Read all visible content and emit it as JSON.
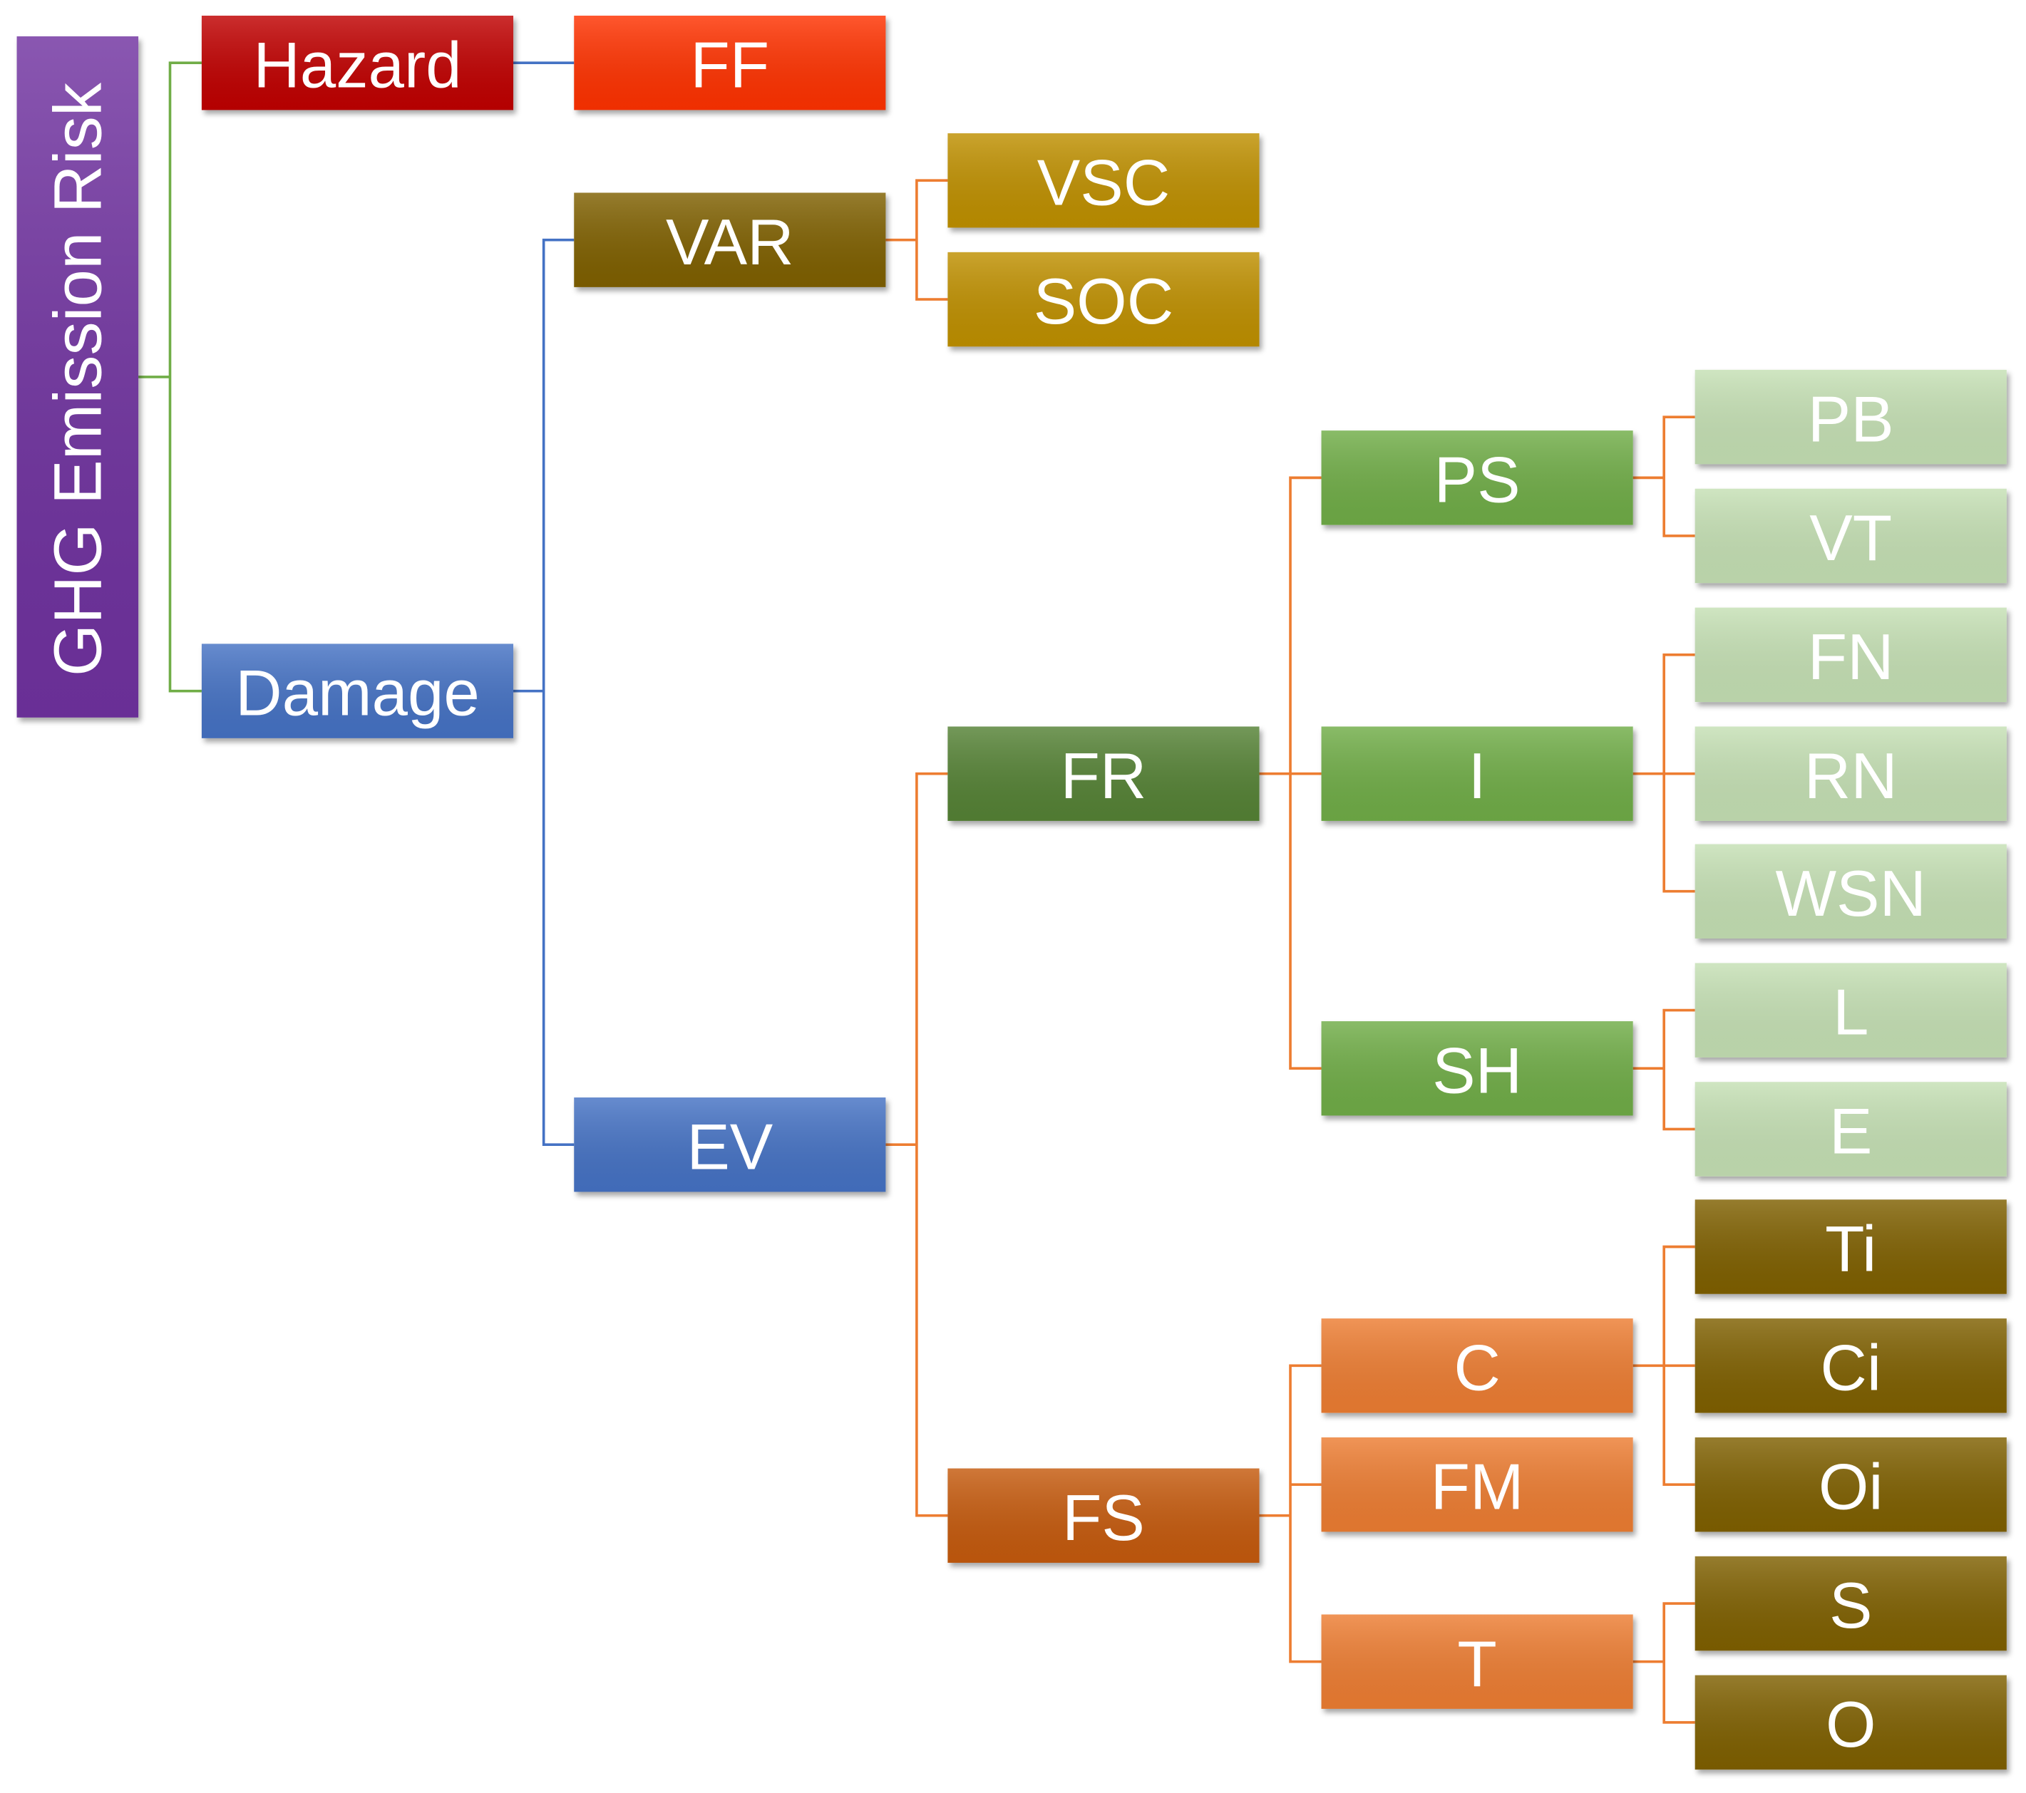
{
  "diagram": {
    "nodes": [
      {
        "id": "root",
        "label": "GHG Emission Risk",
        "parent": null,
        "color": "#7030a0"
      },
      {
        "id": "hazard",
        "label": "Hazard",
        "parent": "root",
        "color": "#c00000"
      },
      {
        "id": "ff",
        "label": "FF",
        "parent": "hazard",
        "color": "#ff3300"
      },
      {
        "id": "damage",
        "label": "Damage",
        "parent": "root",
        "color": "#4472c4"
      },
      {
        "id": "var",
        "label": "VAR",
        "parent": "damage",
        "color": "#7f6000"
      },
      {
        "id": "vsc",
        "label": "VSC",
        "parent": "var",
        "color": "#bf9000"
      },
      {
        "id": "soc",
        "label": "SOC",
        "parent": "var",
        "color": "#bf9000"
      },
      {
        "id": "ev",
        "label": "EV",
        "parent": "damage",
        "color": "#4472c4"
      },
      {
        "id": "fr",
        "label": "FR",
        "parent": "ev",
        "color": "#548235"
      },
      {
        "id": "ps",
        "label": "PS",
        "parent": "fr",
        "color": "#70ad47"
      },
      {
        "id": "pb",
        "label": "PB",
        "parent": "ps",
        "color": "#c5e0b4"
      },
      {
        "id": "vt",
        "label": "VT",
        "parent": "ps",
        "color": "#c5e0b4"
      },
      {
        "id": "i",
        "label": "I",
        "parent": "fr",
        "color": "#70ad47"
      },
      {
        "id": "fn",
        "label": "FN",
        "parent": "i",
        "color": "#c5e0b4"
      },
      {
        "id": "rn",
        "label": "RN",
        "parent": "i",
        "color": "#c5e0b4"
      },
      {
        "id": "wsn",
        "label": "WSN",
        "parent": "i",
        "color": "#c5e0b4"
      },
      {
        "id": "sh",
        "label": "SH",
        "parent": "fr",
        "color": "#70ad47"
      },
      {
        "id": "l",
        "label": "L",
        "parent": "sh",
        "color": "#c5e0b4"
      },
      {
        "id": "e",
        "label": "E",
        "parent": "sh",
        "color": "#c5e0b4"
      },
      {
        "id": "fs",
        "label": "FS",
        "parent": "ev",
        "color": "#c55a11"
      },
      {
        "id": "c",
        "label": "C",
        "parent": "fs",
        "color": "#ed7d31"
      },
      {
        "id": "ti",
        "label": "Ti",
        "parent": "c",
        "color": "#7f6000"
      },
      {
        "id": "ci",
        "label": "Ci",
        "parent": "c",
        "color": "#7f6000"
      },
      {
        "id": "oi",
        "label": "Oi",
        "parent": "c",
        "color": "#7f6000"
      },
      {
        "id": "fm",
        "label": "FM",
        "parent": "fs",
        "color": "#ed7d31"
      },
      {
        "id": "t",
        "label": "T",
        "parent": "fs",
        "color": "#ed7d31"
      },
      {
        "id": "s",
        "label": "S",
        "parent": "t",
        "color": "#7f6000"
      },
      {
        "id": "o",
        "label": "O",
        "parent": "t",
        "color": "#7f6000"
      }
    ],
    "connector_colors": {
      "root": "#70ad47",
      "hazard": "#4472c4",
      "damage": "#4472c4",
      "var": "#ed7d31",
      "ev": "#ed7d31",
      "fr": "#ed7d31",
      "fs": "#ed7d31",
      "ps": "#ed7d31",
      "i": "#ed7d31",
      "sh": "#ed7d31",
      "c": "#ed7d31",
      "t": "#ed7d31"
    }
  }
}
